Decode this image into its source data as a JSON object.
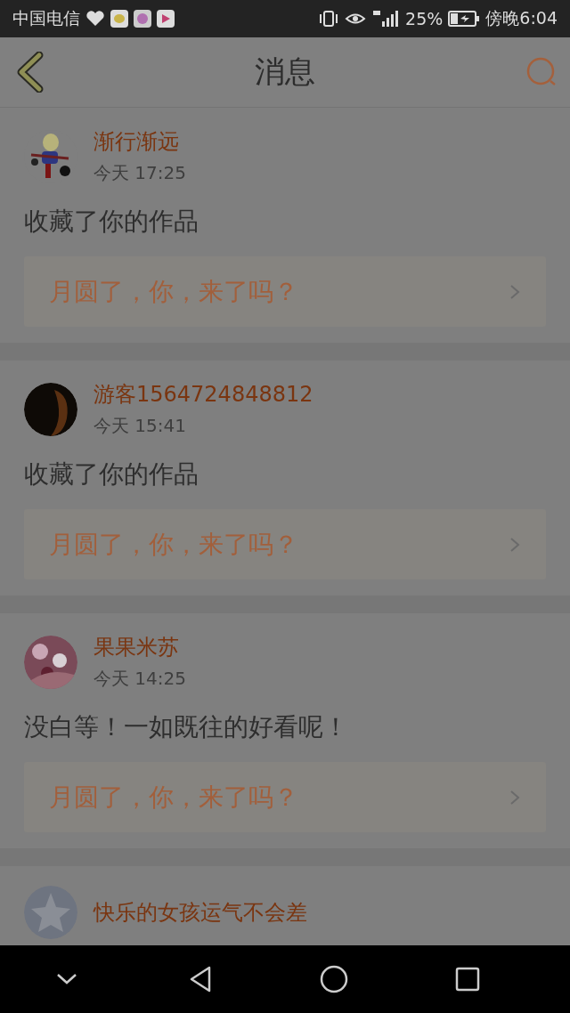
{
  "status_bar": {
    "carrier": "中国电信",
    "battery": "25%",
    "time": "傍晚6:04"
  },
  "header": {
    "title": "消息"
  },
  "messages": [
    {
      "name": "渐行渐远",
      "time": "今天 17:25",
      "action": "收藏了你的作品",
      "work": "月圆了，你，来了吗？"
    },
    {
      "name": "游客1564724848812",
      "time": "今天 15:41",
      "action": "收藏了你的作品",
      "work": "月圆了，你，来了吗？"
    },
    {
      "name": "果果米苏",
      "time": "今天 14:25",
      "action": "没白等！一如既往的好看呢！",
      "work": "月圆了，你，来了吗？"
    },
    {
      "name": "快乐的女孩运气不会差"
    }
  ]
}
